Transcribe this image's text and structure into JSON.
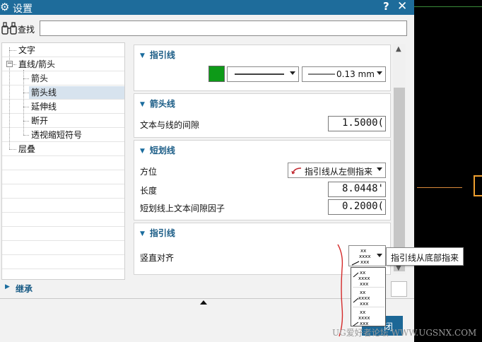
{
  "window": {
    "title": "设置",
    "help_label": "?",
    "close_label": "✕"
  },
  "find": {
    "label": "查找",
    "value": "",
    "icon": "binoculars-icon"
  },
  "tree": {
    "items": [
      {
        "label": "文字",
        "level": 1
      },
      {
        "label": "直线/箭头",
        "level": 1,
        "expanded": true
      },
      {
        "label": "箭头",
        "level": 2
      },
      {
        "label": "箭头线",
        "level": 2,
        "selected": true
      },
      {
        "label": "延伸线",
        "level": 2
      },
      {
        "label": "断开",
        "level": 2
      },
      {
        "label": "透视缩短符号",
        "level": 2
      },
      {
        "label": "层叠",
        "level": 1
      }
    ],
    "toggle_symbol": "−"
  },
  "sections": {
    "leader1": {
      "title": "指引线",
      "line_color": "#0d9a18",
      "line_width": "0.13 mm"
    },
    "arrow": {
      "title": "箭头线",
      "gap_label": "文本与线的间隙",
      "gap_value": "1.5000("
    },
    "stub": {
      "title": "短划线",
      "direction_label": "方位",
      "direction_value": "指引线从左侧指来",
      "length_label": "长度",
      "length_value": "8.0448'",
      "gap_factor_label": "短划线上文本间隙因子",
      "gap_factor_value": "0.2000("
    },
    "leader2": {
      "title": "指引线",
      "vertical_align_label": "竖直对齐"
    }
  },
  "popup": {
    "tooltip": "指引线从底部指来",
    "sample_text": [
      "xx",
      "xxxx",
      "xxx"
    ]
  },
  "inherit": {
    "title": "继承"
  },
  "footer": {
    "close_label": "闭"
  },
  "watermark": "UG爱好者论坛 WWW.UGSNX.COM"
}
